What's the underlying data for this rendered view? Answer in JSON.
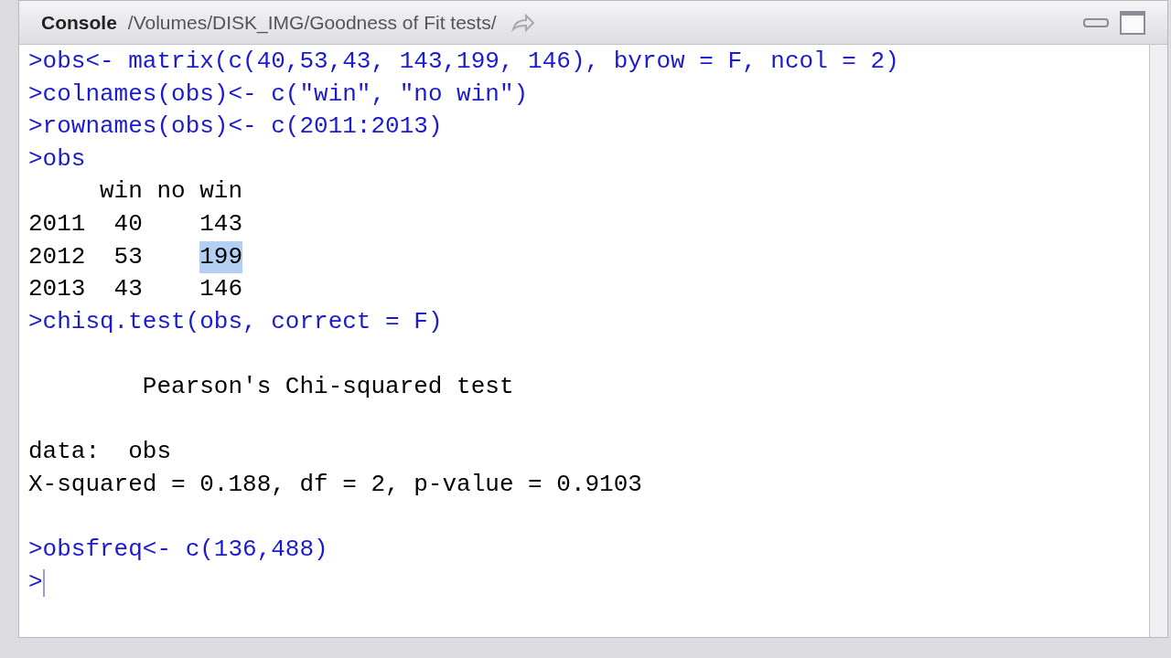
{
  "pane": {
    "title": "Console",
    "path": "/Volumes/DISK_IMG/Goodness of Fit tests/"
  },
  "lines": [
    {
      "kind": "input",
      "prompt": ">",
      "text": "obs<- matrix(c(40,53,43, 143,199, 146), byrow = F, ncol = 2)"
    },
    {
      "kind": "input",
      "prompt": ">",
      "text": "colnames(obs)<- c(\"win\", \"no win\")"
    },
    {
      "kind": "input",
      "prompt": ">",
      "text": "rownames(obs)<- c(2011:2013)"
    },
    {
      "kind": "input",
      "prompt": ">",
      "text": "obs"
    },
    {
      "kind": "output",
      "segments": [
        {
          "text": "     win no win",
          "selected": false
        }
      ]
    },
    {
      "kind": "output",
      "segments": [
        {
          "text": "2011  40    143",
          "selected": false
        }
      ]
    },
    {
      "kind": "output",
      "segments": [
        {
          "text": "2012  53    ",
          "selected": false
        },
        {
          "text": "199",
          "selected": true
        }
      ]
    },
    {
      "kind": "output",
      "segments": [
        {
          "text": "2013  43    146",
          "selected": false
        }
      ]
    },
    {
      "kind": "input",
      "prompt": ">",
      "text": "chisq.test(obs, correct = F)"
    },
    {
      "kind": "blank"
    },
    {
      "kind": "output",
      "segments": [
        {
          "text": "        Pearson's Chi-squared test",
          "selected": false
        }
      ]
    },
    {
      "kind": "blank"
    },
    {
      "kind": "output",
      "segments": [
        {
          "text": "data:  obs",
          "selected": false
        }
      ]
    },
    {
      "kind": "output",
      "segments": [
        {
          "text": "X-squared = 0.188, df = 2, p-value = 0.9103",
          "selected": false
        }
      ]
    },
    {
      "kind": "blank"
    },
    {
      "kind": "input",
      "prompt": ">",
      "text": "obsfreq<- c(136,488)"
    },
    {
      "kind": "cursor",
      "prompt": ">"
    }
  ]
}
